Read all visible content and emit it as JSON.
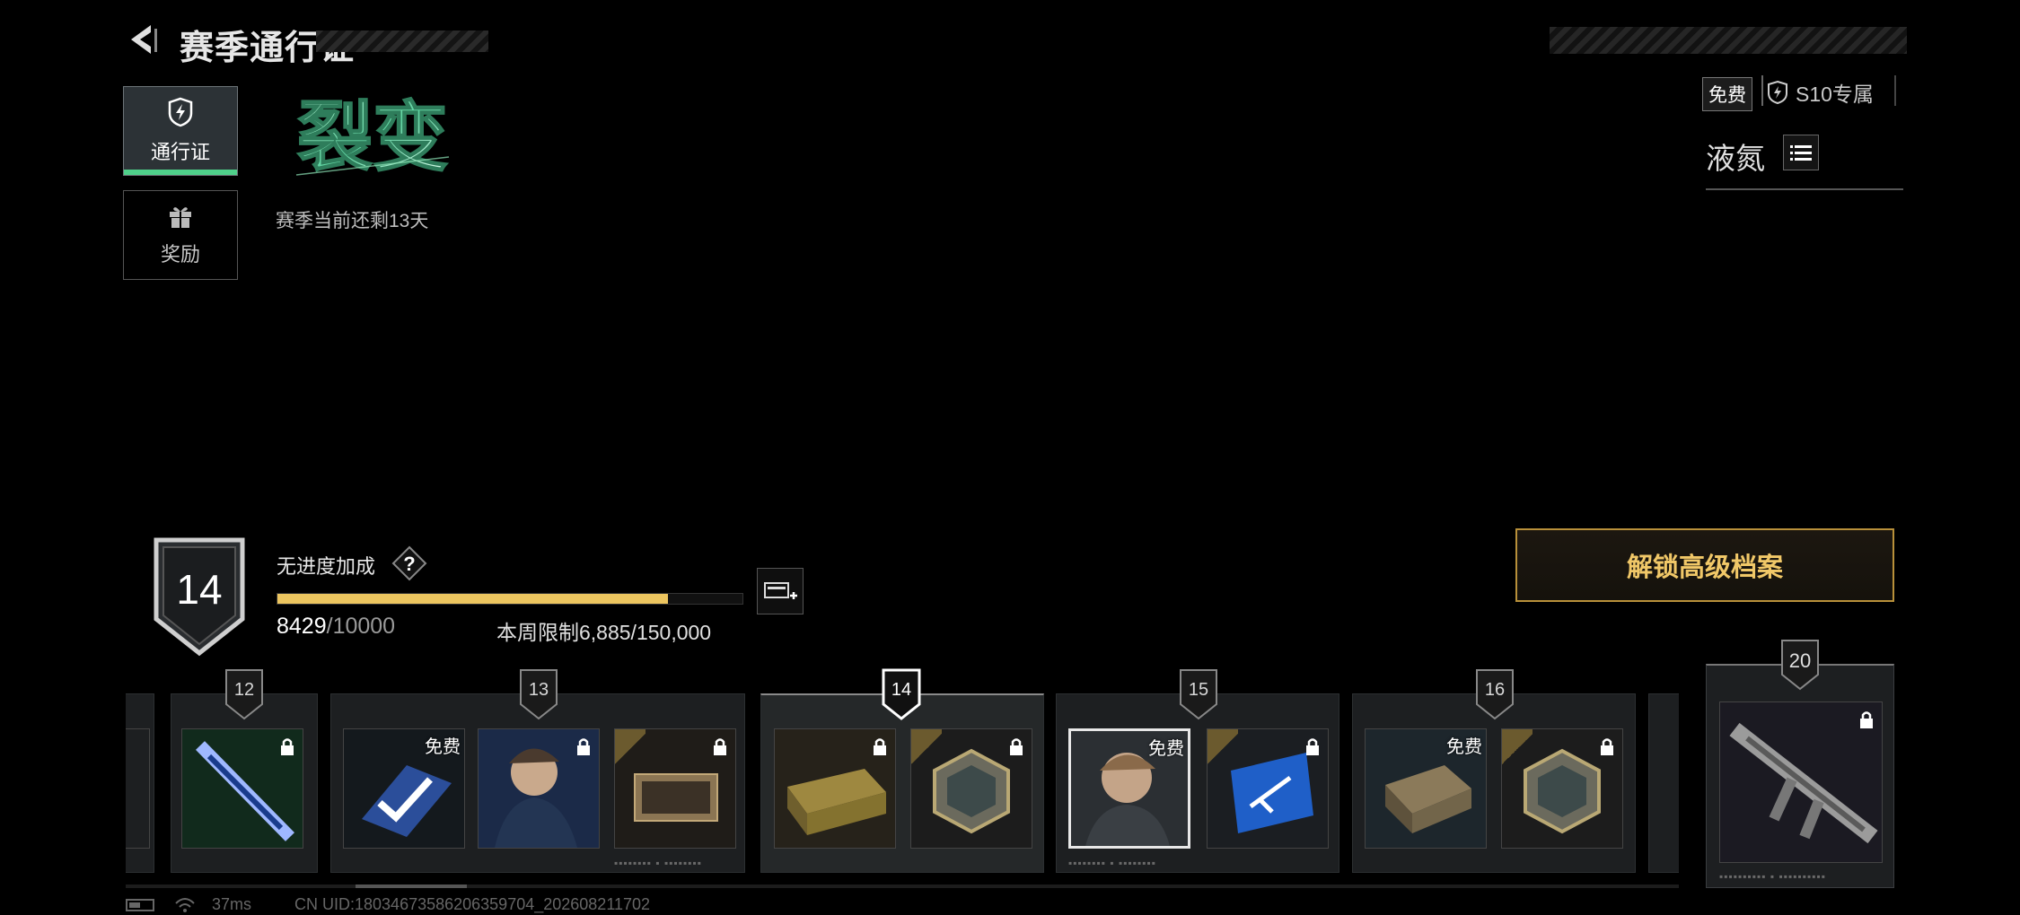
{
  "header": {
    "title": "赛季通行证"
  },
  "tabs": [
    {
      "label": "通行证",
      "icon": "pass-shield-icon",
      "active": true
    },
    {
      "label": "奖励",
      "icon": "gift-icon",
      "active": false
    }
  ],
  "season": {
    "logo_text": "裂变",
    "days_left": "赛季当前还剩13天"
  },
  "top_right": {
    "free_tag": "免费",
    "exclusive_tag": "S10专属",
    "ln2_label": "液氮"
  },
  "level": {
    "current": "14",
    "bonus_label": "无进度加成",
    "help": "?",
    "xp_current": "8429",
    "xp_max": "/10000",
    "xp_progress": 0.8429,
    "weekly_limit": "本周限制6,885/150,000"
  },
  "unlock_button": "解锁高级档案",
  "rewards": {
    "tiers": [
      "12",
      "13",
      "14",
      "15",
      "16"
    ],
    "final_tier": "20",
    "free_label": "免费"
  },
  "status_bar": {
    "ping": "37ms",
    "uid": "CN UID:1803467358620635970​4_202608211702"
  },
  "colors": {
    "accent_green": "#4fd08a",
    "gold": "#f1c868",
    "xp_bar": "#ecc55f"
  }
}
